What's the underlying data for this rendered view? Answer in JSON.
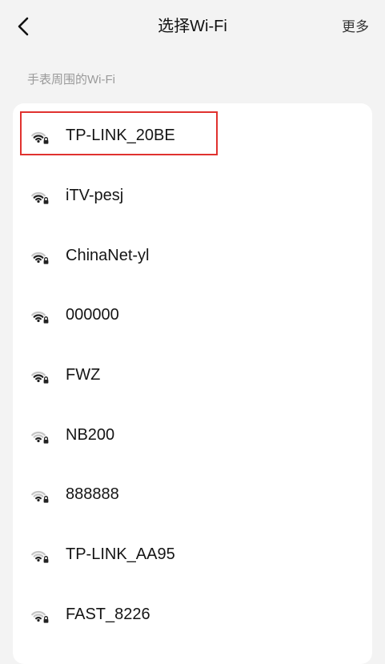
{
  "header": {
    "back_icon": "chevron-left-icon",
    "title": "选择Wi-Fi",
    "more_label": "更多"
  },
  "section": {
    "label": "手表周围的Wi-Fi"
  },
  "networks": [
    {
      "ssid": "TP-LINK_20BE",
      "icon": "wifi-locked-icon",
      "signal": "full"
    },
    {
      "ssid": "iTV-pesj",
      "icon": "wifi-locked-icon",
      "signal": "full"
    },
    {
      "ssid": "ChinaNet-yl",
      "icon": "wifi-locked-icon",
      "signal": "full"
    },
    {
      "ssid": "000000",
      "icon": "wifi-locked-icon",
      "signal": "full"
    },
    {
      "ssid": "FWZ",
      "icon": "wifi-locked-icon",
      "signal": "full"
    },
    {
      "ssid": "NB200",
      "icon": "wifi-locked-icon",
      "signal": "weak"
    },
    {
      "ssid": "888888",
      "icon": "wifi-locked-icon",
      "signal": "weak"
    },
    {
      "ssid": "TP-LINK_AA95",
      "icon": "wifi-locked-icon",
      "signal": "weak"
    },
    {
      "ssid": "FAST_8226",
      "icon": "wifi-locked-icon",
      "signal": "weak"
    }
  ],
  "colors": {
    "background": "#f3f3f3",
    "card": "#ffffff",
    "highlight": "#e0322f",
    "muted_text": "#9a9a9a",
    "icon_strong": "#222222",
    "icon_weak": "#c4c4c4"
  }
}
